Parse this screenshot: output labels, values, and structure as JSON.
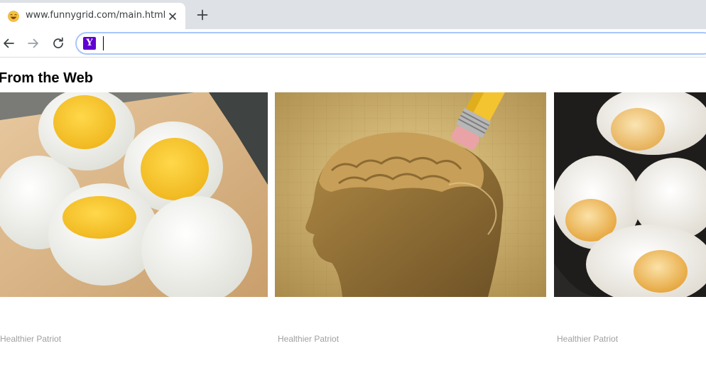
{
  "browser": {
    "tab": {
      "title": "www.funnygrid.com/main.html",
      "favicon": "laughing-emoji-icon"
    },
    "new_tab_icon": "plus-icon",
    "toolbar": {
      "back_icon": "arrow-left-icon",
      "forward_icon": "arrow-right-icon",
      "reload_icon": "reload-icon",
      "search_engine_icon": "yahoo-icon",
      "search_engine_letter": "Y",
      "address_value": ""
    }
  },
  "content": {
    "section_title": "From the Web",
    "cards": [
      {
        "image": "boiled-eggs-photo",
        "source": "Healthier Patriot"
      },
      {
        "image": "brain-pencil-eraser-illustration",
        "source": "Healthier Patriot"
      },
      {
        "image": "fried-eggs-photo",
        "source": "Healthier Patriot"
      }
    ]
  },
  "colors": {
    "tabstrip_bg": "#dee1e6",
    "omnibox_focus": "#a8c7fa",
    "yahoo_purple": "#5f01d1",
    "source_text": "#a0a0a0"
  }
}
